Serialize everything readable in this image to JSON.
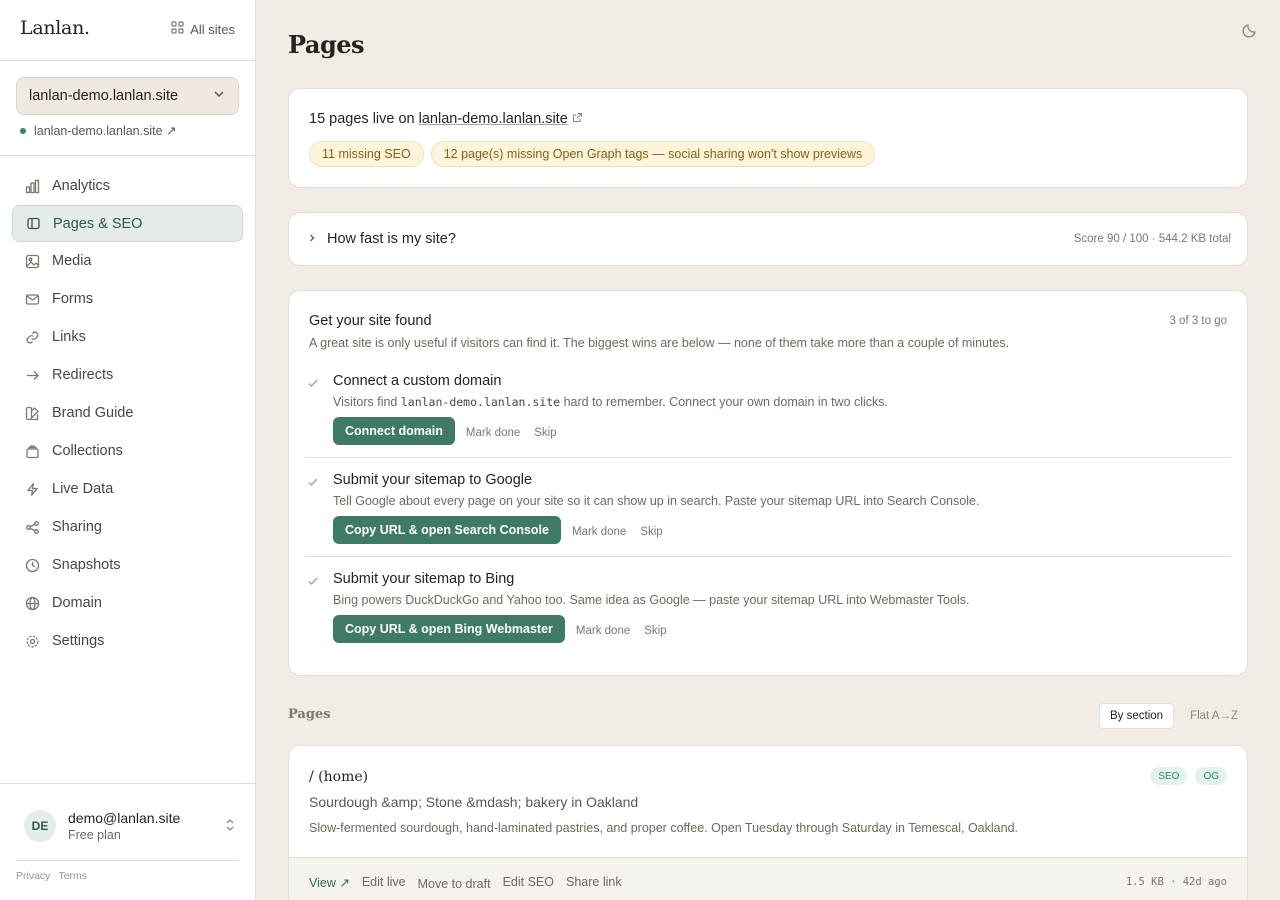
{
  "sidebar": {
    "logo": "Lanlan.",
    "all_sites": "All sites",
    "site_select": "lanlan-demo.lanlan.site",
    "site_link": "lanlan-demo.lanlan.site ↗",
    "nav": [
      {
        "label": "Analytics",
        "icon": "chart-icon"
      },
      {
        "label": "Pages & SEO",
        "icon": "page-icon"
      },
      {
        "label": "Media",
        "icon": "image-icon"
      },
      {
        "label": "Forms",
        "icon": "mail-icon"
      },
      {
        "label": "Links",
        "icon": "link-icon"
      },
      {
        "label": "Redirects",
        "icon": "arrow-right-icon"
      },
      {
        "label": "Brand Guide",
        "icon": "palette-icon"
      },
      {
        "label": "Collections",
        "icon": "database-icon"
      },
      {
        "label": "Live Data",
        "icon": "bolt-icon"
      },
      {
        "label": "Sharing",
        "icon": "share-icon"
      },
      {
        "label": "Snapshots",
        "icon": "clock-icon"
      },
      {
        "label": "Domain",
        "icon": "globe-icon"
      },
      {
        "label": "Settings",
        "icon": "gear-icon"
      }
    ],
    "user": {
      "initials": "DE",
      "email": "demo@lanlan.site",
      "plan": "Free plan"
    },
    "legal": {
      "privacy": "Privacy",
      "terms": "Terms"
    }
  },
  "main": {
    "title": "Pages",
    "summary": {
      "prefix": "15 pages live on ",
      "domain": "lanlan-demo.lanlan.site",
      "chips": [
        "11 missing SEO",
        "12 page(s) missing Open Graph tags — social sharing won't show previews"
      ]
    },
    "speed": {
      "question": "How fast is my site?",
      "score": "Score 90 / 100 · 544.2 KB total"
    },
    "found": {
      "title": "Get your site found",
      "count": "3 of 3 to go",
      "subtitle": "A great site is only useful if visitors can find it. The biggest wins are below — none of them take more than a couple of minutes.",
      "steps": [
        {
          "title": "Connect a custom domain",
          "desc_pre": "Visitors find ",
          "desc_code": "lanlan-demo.lanlan.site",
          "desc_post": " hard to remember. Connect your own domain in two clicks.",
          "button": "Connect domain",
          "done": "Mark done",
          "skip": "Skip"
        },
        {
          "title": "Submit your sitemap to Google",
          "desc": "Tell Google about every page on your site so it can show up in search. Paste your sitemap URL into Search Console.",
          "button": "Copy URL & open Search Console",
          "done": "Mark done",
          "skip": "Skip"
        },
        {
          "title": "Submit your sitemap to Bing",
          "desc": "Bing powers DuckDuckGo and Yahoo too. Same idea as Google — paste your sitemap URL into Webmaster Tools.",
          "button": "Copy URL & open Bing Webmaster",
          "done": "Mark done",
          "skip": "Skip"
        }
      ]
    },
    "pages_heading": "Pages",
    "view_modes": {
      "by_section": "By section",
      "flat": "Flat A→Z"
    },
    "page_card": {
      "path": "/ (home)",
      "badges": [
        "SEO",
        "OG"
      ],
      "title": "Sourdough &amp; Stone &mdash; bakery in Oakland",
      "description": "Slow-fermented sourdough, hand-laminated pastries, and proper coffee. Open Tuesday through Saturday in Temescal, Oakland.",
      "actions": {
        "view": "View ↗",
        "edit_live": "Edit live",
        "draft": "Move to draft",
        "edit_seo": "Edit SEO",
        "share": "Share link"
      },
      "meta": "1.5 KB · 42d ago"
    }
  }
}
